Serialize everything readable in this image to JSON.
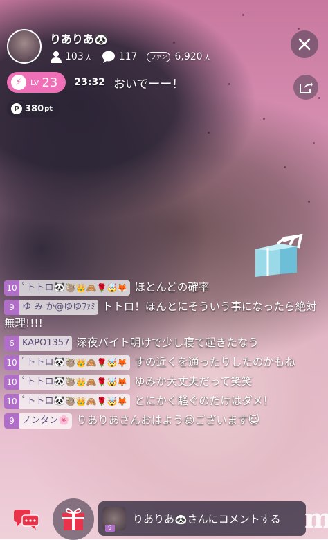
{
  "streamer": {
    "name": "りありあ🐼",
    "followers": "103",
    "followers_unit": "人",
    "comments": "117",
    "fan_badge": "ファン",
    "fans": "6,920",
    "fans_unit": "人"
  },
  "level": {
    "prefix": "LV",
    "number": "23"
  },
  "header_comment": {
    "time": "23:32",
    "text": "おいでーー！"
  },
  "points": {
    "icon": "P",
    "value": "380",
    "unit": "pt"
  },
  "chat": [
    {
      "level": "10",
      "nick": "ﾟトトロ🐼",
      "badges": "🦥👑🙈🌹🤯🦊",
      "text": "ほとんどの確率"
    },
    {
      "level": "9",
      "nick": "ゆ み か@ゆゆﾌｧﾐ",
      "badges": "",
      "text": "トトロ！ほんとにそういう事になったら絶対無理!!!!"
    },
    {
      "level": "6",
      "nick": "KAPO1357",
      "badges": "",
      "text": "深夜バイト明けで少し寝て起きたなう"
    },
    {
      "level": "10",
      "nick": "ﾟトトロ🐼",
      "badges": "🦥👑🙈🌹🤯🦊",
      "text": "すの近くを通ったりしたのかもね"
    },
    {
      "level": "10",
      "nick": "ﾟトトロ🐼",
      "badges": "🦥👑🙈🌹🤯🦊",
      "text": "ゆみか大丈夫だって笑笑"
    },
    {
      "level": "10",
      "nick": "ﾟトトロ🐼",
      "badges": "🦥👑🙈🌹🤯🦊",
      "text": "とにかく騒ぐのだけはダメ！"
    },
    {
      "level": "9",
      "nick": "ノンタン🌸",
      "badges": "",
      "text": "りありあさんおはよう😃ございます😺"
    }
  ],
  "bottom": {
    "comment_placeholder": "りありあ🐼さんにコメントする",
    "mini_level": "9",
    "logo": "m"
  },
  "colors": {
    "level_pill": "#f070b8",
    "chat_level": "#b06ec8"
  }
}
